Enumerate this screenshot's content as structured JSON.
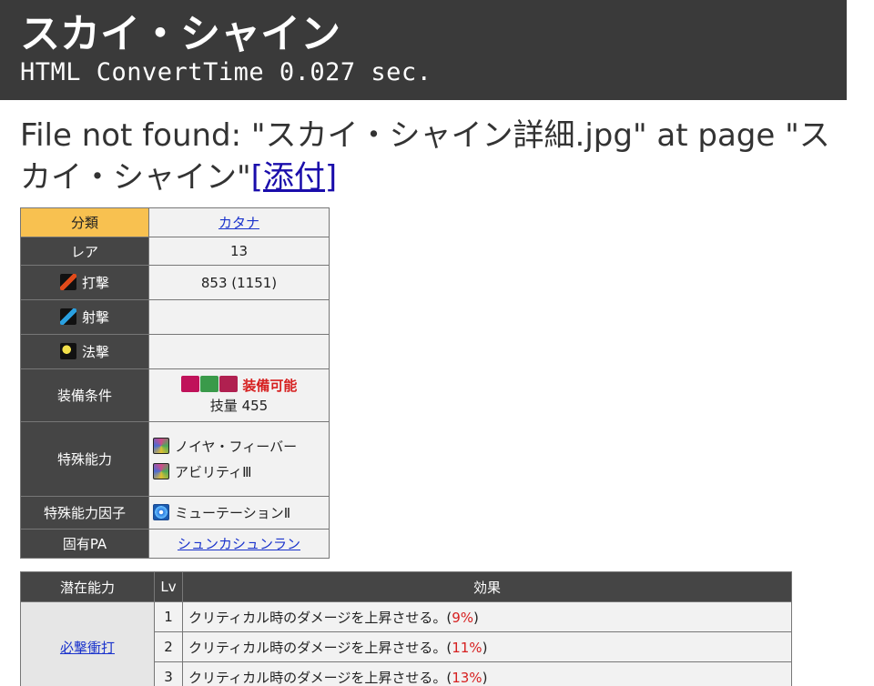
{
  "header": {
    "title": "スカイ・シャイン",
    "convert_time": "HTML ConvertTime 0.027 sec."
  },
  "notice": {
    "text": "File not found: \"スカイ・シャイン詳細.jpg\" at page \"スカイ・シャイン\"",
    "link": "[添付]"
  },
  "spec": {
    "category_label": "分類",
    "category_value": "カタナ",
    "rarity_label": "レア",
    "rarity_value": "13",
    "strike_label": "打撃",
    "strike_value": "853 (1151)",
    "shoot_label": "射撃",
    "shoot_value": "",
    "tech_label": "法撃",
    "tech_value": "",
    "equip_label": "装備条件",
    "equip_status": "装備可能",
    "equip_requirement": "技量 455",
    "special_label": "特殊能力",
    "special_items": [
      "ノイヤ・フィーバー",
      "アビリティⅢ"
    ],
    "factor_label": "特殊能力因子",
    "factor_value": "ミューテーションⅡ",
    "pa_label": "固有PA",
    "pa_value": "シュンカシュンラン"
  },
  "potential": {
    "headers": [
      "潜在能力",
      "Lv",
      "効果"
    ],
    "name": "必撃衝打",
    "rows": [
      {
        "lv": "1",
        "text": "クリティカル時のダメージを上昇させる。(",
        "pct": "9%",
        "close": ")"
      },
      {
        "lv": "2",
        "text": "クリティカル時のダメージを上昇させる。(",
        "pct": "11%",
        "close": ")"
      },
      {
        "lv": "3",
        "text": "クリティカル時のダメージを上昇させる。(",
        "pct": "13%",
        "close": ")"
      }
    ]
  },
  "colors": {
    "header_bg": "#3a3a3a",
    "label_bg": "#454545",
    "category_bg": "#f8c150",
    "value_bg": "#f2f2f2",
    "link": "#1a33cc",
    "accent_red": "#d62020"
  }
}
